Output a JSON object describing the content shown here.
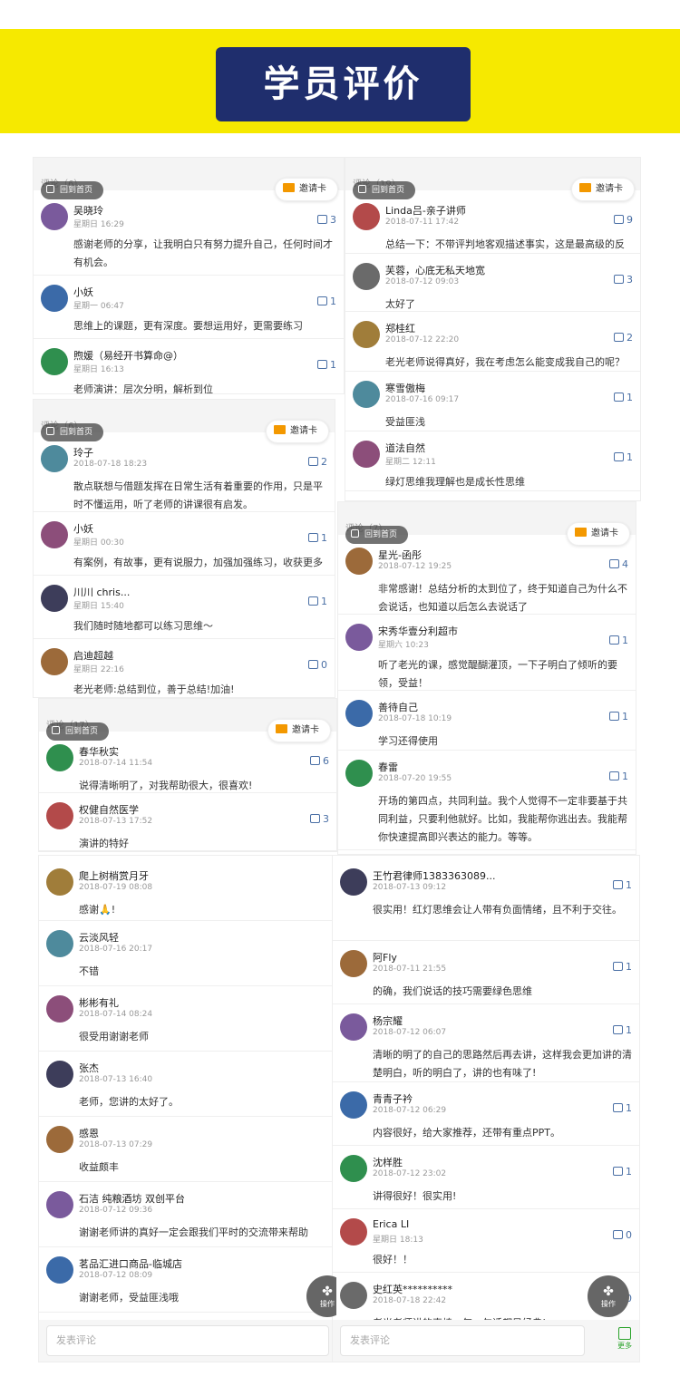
{
  "header": {
    "title": "学员评价"
  },
  "common": {
    "home": "回到首页",
    "invite": "邀请卡",
    "comment_placeholder": "发表评论",
    "op": "操作",
    "more": "更多"
  },
  "panels": {
    "p1": {
      "count": "评论（6）",
      "items": [
        {
          "name": "吴晓玲",
          "time": "星期日 16:29",
          "text": "感谢老师的分享，让我明白只有努力提升自己，任何时间才有机会。",
          "likes": "3"
        },
        {
          "name": "小妖",
          "time": "星期一 06:47",
          "text": "思维上的课题，更有深度。要想运用好，更需要练习",
          "likes": "1"
        },
        {
          "name": "煦媛（易经开书算命@）",
          "time": "星期日 16:13",
          "text": "老师演讲：层次分明，解析到位",
          "likes": "1"
        }
      ]
    },
    "p2": {
      "count": "评论（19）",
      "items": [
        {
          "name": "Linda吕-亲子讲师",
          "time": "2018-07-11 17:42",
          "text": "总结一下：不带评判地客观描述事实，这是最高级的反馈",
          "likes": "9"
        },
        {
          "name": "芙蓉，心底无私天地宽",
          "time": "2018-07-12 09:03",
          "text": "太好了",
          "likes": "3"
        },
        {
          "name": "郑桂红",
          "time": "2018-07-12 22:20",
          "text": "老光老师说得真好，我在考虑怎么能变成我自己的呢？",
          "likes": "2"
        },
        {
          "name": "寒雪傲梅",
          "time": "2018-07-16 09:17",
          "text": "受益匪浅",
          "likes": "1"
        },
        {
          "name": "道法自然",
          "time": "星期二 12:11",
          "text": "绿灯思维我理解也是成长性思维",
          "likes": "1"
        }
      ]
    },
    "p3": {
      "count": "评论（6）",
      "items": [
        {
          "name": "玲子",
          "time": "2018-07-18 18:23",
          "text": "散点联想与借题发挥在日常生活有着重要的作用，只是平时不懂运用，听了老师的讲课很有启发。",
          "likes": "2"
        },
        {
          "name": "小妖",
          "time": "星期日 00:30",
          "text": "有案例，有故事，更有说服力，加强加强练习，收获更多",
          "likes": "1"
        },
        {
          "name": "川川 chris...",
          "time": "星期日 15:40",
          "text": "我们随时随地都可以练习思维～",
          "likes": "1"
        },
        {
          "name": "启迪超越",
          "time": "星期日 22:16",
          "text": "老光老师:总结到位，善于总结!加油!",
          "likes": "0"
        }
      ]
    },
    "p4": {
      "count": "评论（7）",
      "items": [
        {
          "name": "星光-函彤",
          "time": "2018-07-12 19:25",
          "text": "非常感谢！总结分析的太到位了，终于知道自己为什么不会说话，也知道以后怎么去说话了",
          "likes": "4"
        },
        {
          "name": "宋秀华壹分利超市",
          "time": "星期六 10:23",
          "text": "听了老光的课，感觉醍醐灌顶，一下子明白了倾听的要领，受益！",
          "likes": "1"
        },
        {
          "name": "善待自己",
          "time": "2018-07-18 10:19",
          "text": "学习还得使用",
          "likes": "1"
        },
        {
          "name": "春雷",
          "time": "2018-07-20 19:55",
          "text": "开场的第四点，共同利益。我个人觉得不一定非要基于共同利益，只要利他就好。比如，我能帮你逃出去。我能帮你快速提高即兴表达的能力。等等。",
          "likes": "1"
        }
      ]
    },
    "p5": {
      "count": "评论（17）",
      "items": [
        {
          "name": "春华秋实",
          "time": "2018-07-14 11:54",
          "text": "说得清晰明了，对我帮助很大，很喜欢!",
          "likes": "6"
        },
        {
          "name": "权健自然医学",
          "time": "2018-07-13 17:52",
          "text": "演讲的特好",
          "likes": "3"
        }
      ]
    },
    "p6": {
      "items": [
        {
          "name": "爬上树梢赏月牙",
          "time": "2018-07-19 08:08",
          "text": "感谢🙏!",
          "likes": ""
        },
        {
          "name": "云淡风轻",
          "time": "2018-07-16 20:17",
          "text": "不错",
          "likes": ""
        },
        {
          "name": "彬彬有礼",
          "time": "2018-07-14 08:24",
          "text": "很受用谢谢老师",
          "likes": ""
        },
        {
          "name": "张杰",
          "time": "2018-07-13 16:40",
          "text": "老师，您讲的太好了。",
          "likes": ""
        },
        {
          "name": "感恩",
          "time": "2018-07-13 07:29",
          "text": "收益颇丰",
          "likes": ""
        },
        {
          "name": "石洁 纯粮酒坊 双创平台",
          "time": "2018-07-12 09:36",
          "text": "谢谢老师讲的真好一定会跟我们平时的交流带来帮助",
          "likes": ""
        },
        {
          "name": "茗品汇进口商品-临城店",
          "time": "2018-07-12 08:09",
          "text": "谢谢老师，受益匪浅哦",
          "likes": ""
        }
      ]
    },
    "p7": {
      "items": [
        {
          "name": "王竹君律师1383363089...",
          "time": "2018-07-13 09:12",
          "text": "很实用！红灯思维会让人带有负面情绪，且不利于交往。",
          "likes": "1"
        },
        {
          "name": "阿Fly",
          "time": "2018-07-11 21:55",
          "text": "的确，我们说话的技巧需要绿色思维",
          "likes": "1"
        },
        {
          "name": "杨宗耀",
          "time": "2018-07-12 06:07",
          "text": "清晰的明了的自己的思路然后再去讲，这样我会更加讲的清楚明白，听的明白了，讲的也有味了!",
          "likes": "1"
        },
        {
          "name": "青青子衿",
          "time": "2018-07-12 06:29",
          "text": "内容很好，给大家推荐，还带有重点PPT。",
          "likes": "1"
        },
        {
          "name": "沈样胜",
          "time": "2018-07-12 23:02",
          "text": "讲得很好！很实用!",
          "likes": "1"
        },
        {
          "name": "Erica LI",
          "time": "星期日 18:13",
          "text": "很好！！",
          "likes": "0"
        },
        {
          "name": "史红英**********",
          "time": "2018-07-18 22:42",
          "text": "老光老师讲的真棒，每一句话都是经典!",
          "likes": "0"
        }
      ]
    }
  },
  "colors": {
    "yellow": "#f6e900",
    "navy": "#1f2e6d",
    "accent": "#f39800",
    "green": "#2aa32a"
  }
}
